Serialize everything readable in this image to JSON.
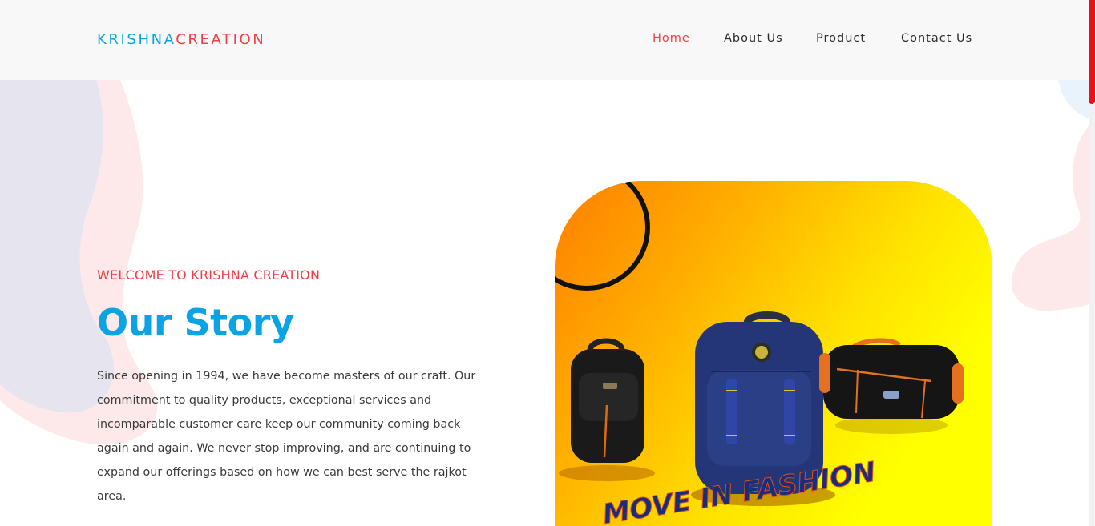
{
  "brand": {
    "part1": "KRISHNA",
    "part2": "CREATION"
  },
  "nav": {
    "items": [
      {
        "label": "Home",
        "active": true
      },
      {
        "label": "About Us",
        "active": false
      },
      {
        "label": "Product",
        "active": false
      },
      {
        "label": "Contact Us",
        "active": false
      }
    ]
  },
  "hero": {
    "eyebrow": "WELCOME TO KRISHNA CREATION",
    "title": "Our Story",
    "story": "Since opening in 1994, we have become masters of our craft. Our commitment to quality products, exceptional services and incomparable customer care keep our community coming back again and again. We never stop improving, and are continuing to expand our offerings based on how we can best serve the rajkot area.",
    "image_caption": "MOVE IN FASHION"
  },
  "colors": {
    "brand_blue": "#0ba3e3",
    "brand_red": "#f23f43",
    "scroll_thumb": "#e8101b"
  }
}
